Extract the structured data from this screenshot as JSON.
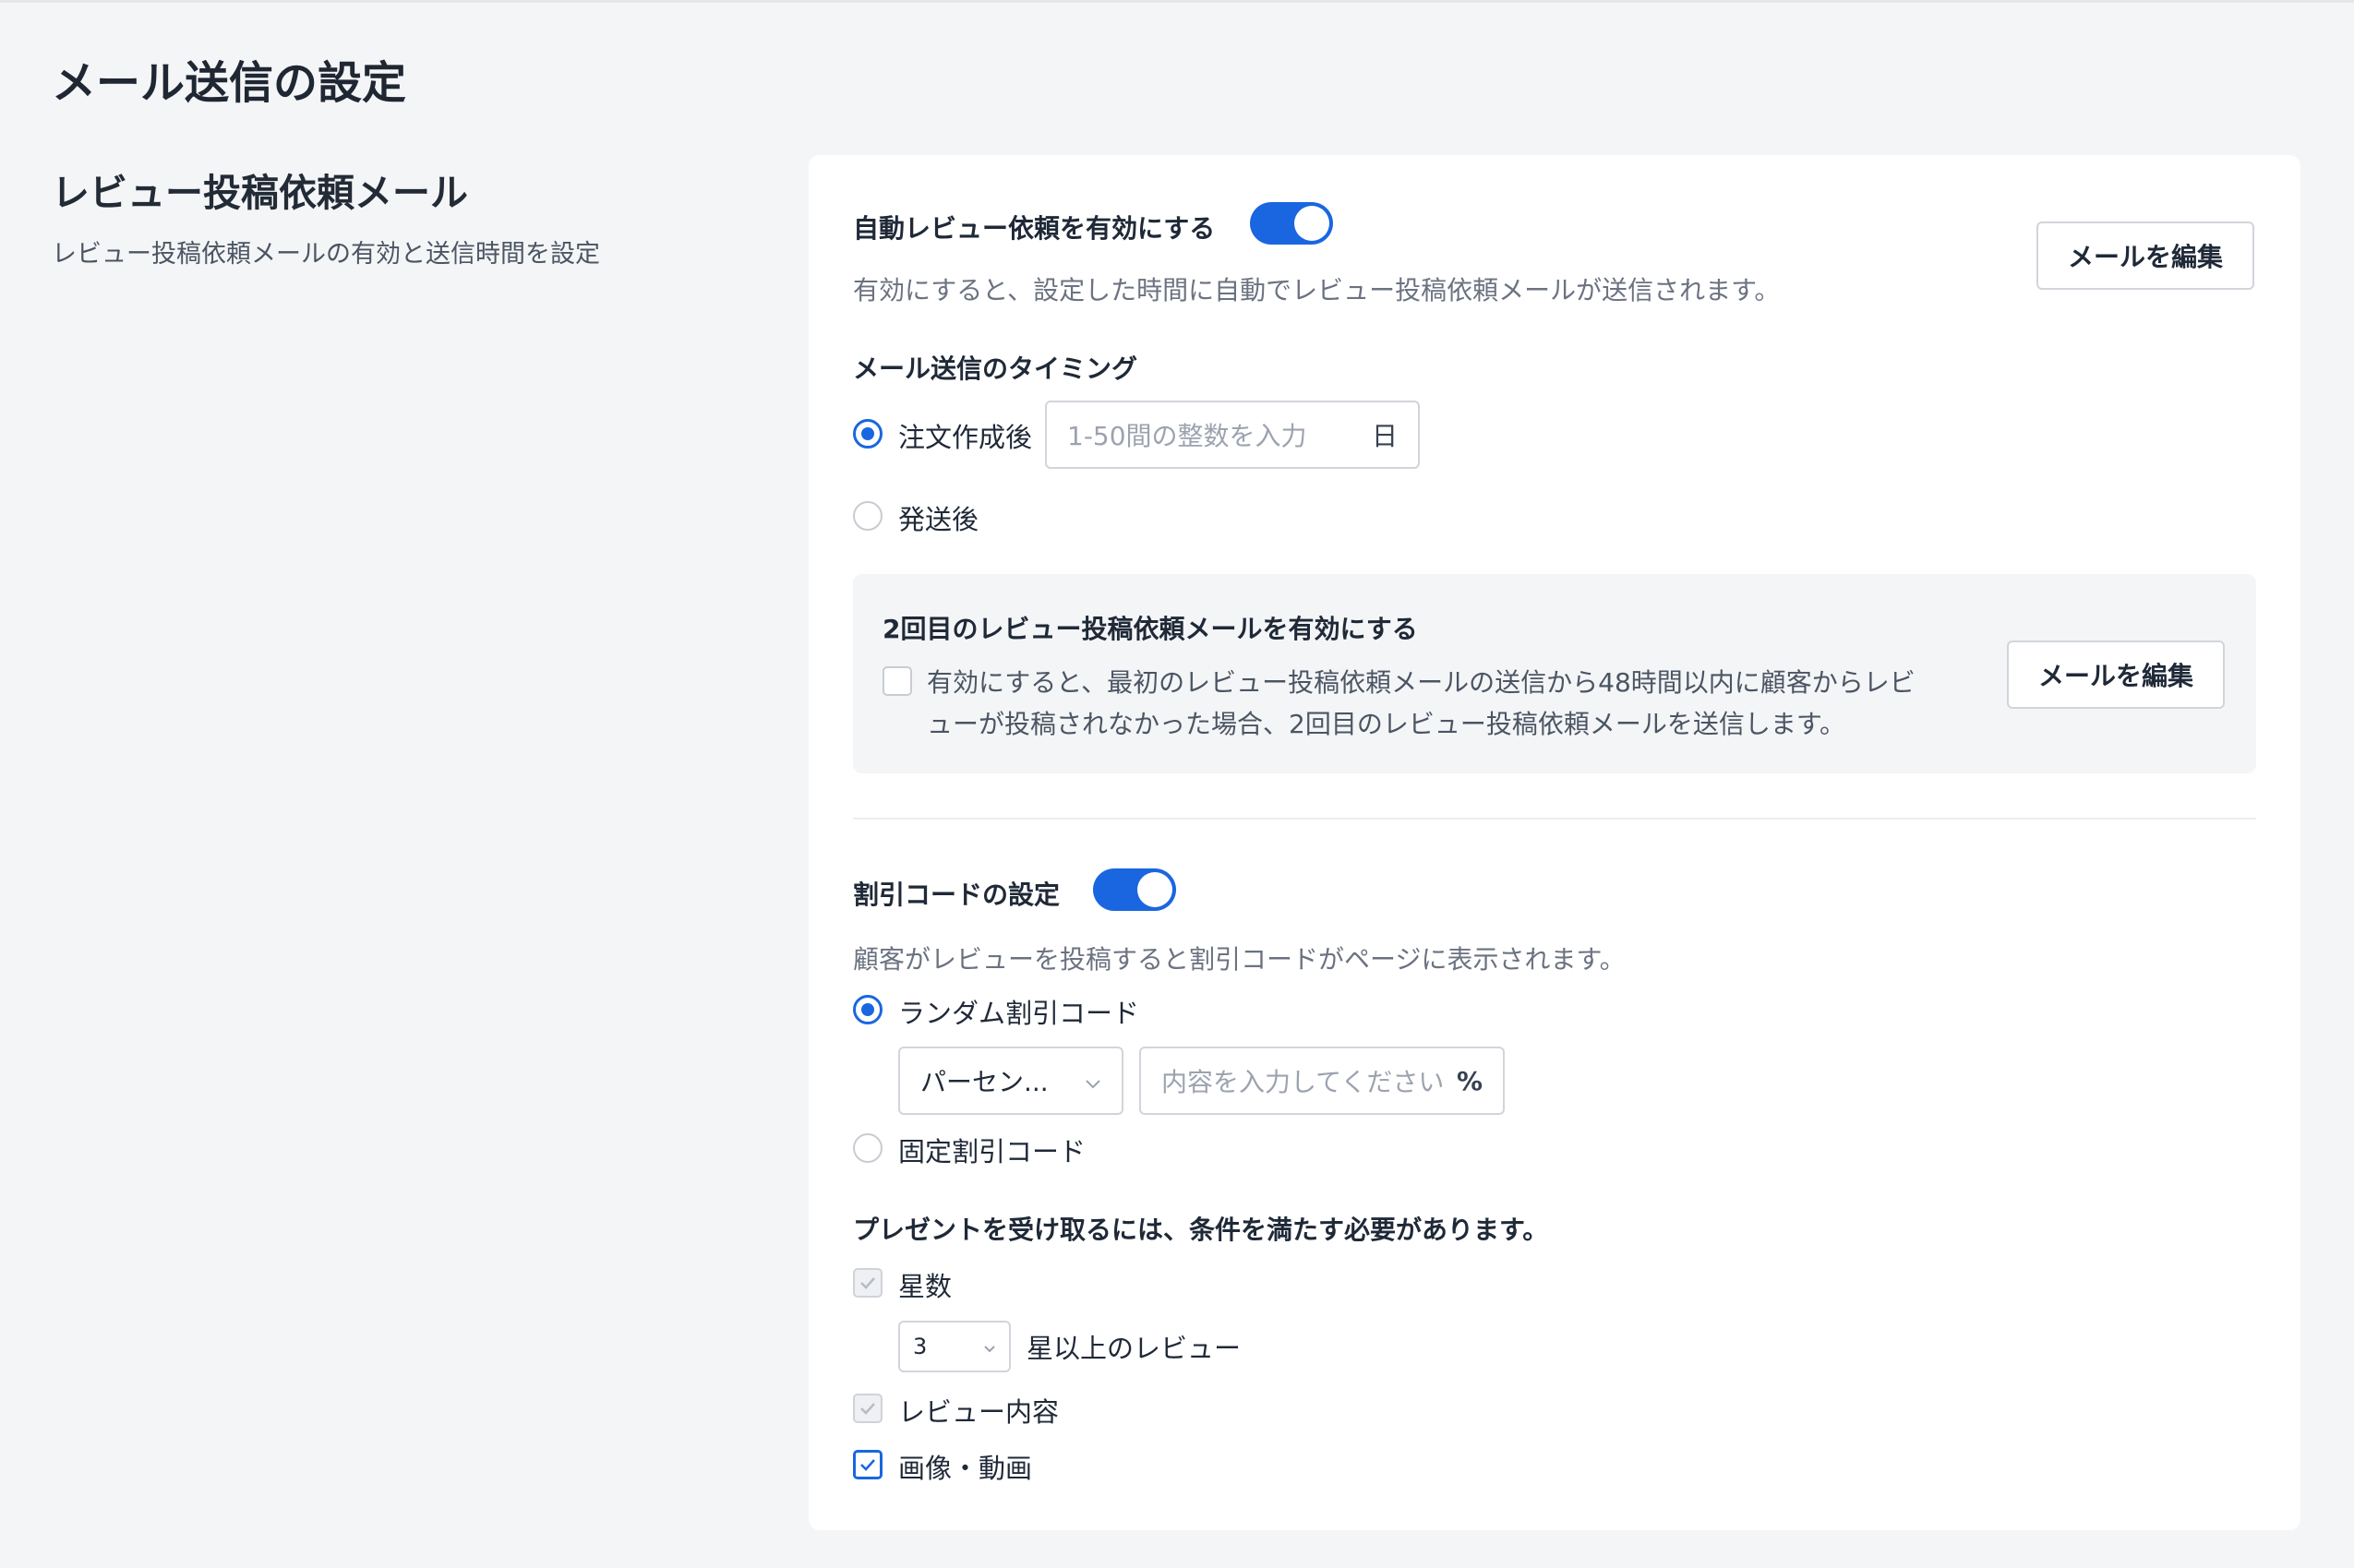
{
  "page": {
    "title": "メール送信の設定"
  },
  "section": {
    "title": "レビュー投稿依頼メール",
    "description": "レビュー投稿依頼メールの有効と送信時間を設定"
  },
  "auto_review": {
    "label": "自動レビュー依頼を有効にする",
    "enabled": true,
    "hint": "有効にすると、設定した時間に自動でレビュー投稿依頼メールが送信されます。",
    "edit_button": "メールを編集"
  },
  "timing": {
    "label": "メール送信のタイミング",
    "option_after_order": "注文作成後",
    "days_placeholder": "1-50間の整数を入力",
    "days_suffix": "日",
    "option_after_shipping": "発送後",
    "selected": "after_order"
  },
  "second_mail": {
    "title": "2回目のレビュー投稿依頼メールを有効にする",
    "hint_line1": "有効にすると、最初のレビュー投稿依頼メールの送信から48時間以内に顧客からレビ",
    "hint_line2": "ューが投稿されなかった場合、2回目のレビュー投稿依頼メールを送信します。",
    "checked": false,
    "edit_button": "メールを編集"
  },
  "discount": {
    "label": "割引コードの設定",
    "enabled": true,
    "hint": "顧客がレビューを投稿すると割引コードがページに表示されます。",
    "option_random": "ランダム割引コード",
    "type_select": "パーセン...",
    "value_placeholder": "内容を入力してください",
    "value_suffix": "%",
    "option_fixed": "固定割引コード",
    "selected": "random"
  },
  "conditions": {
    "label": "プレゼントを受け取るには、条件を満たす必要があります。",
    "stars_label": "星数",
    "stars_value": "3",
    "stars_suffix": "星以上のレビュー",
    "review_content_label": "レビュー内容",
    "media_label": "画像・動画"
  },
  "colors": {
    "accent": "#1a66e0",
    "background": "#f4f5f7",
    "card": "#ffffff"
  }
}
